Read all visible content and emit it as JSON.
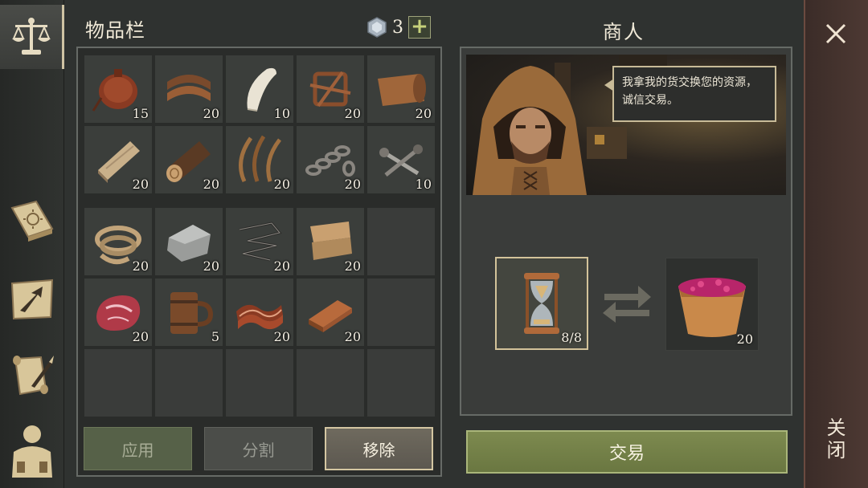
{
  "inventory": {
    "title": "物品栏",
    "gem_count": "3",
    "plus_label": "+",
    "grid_a": [
      {
        "icon": "leather-waterskin-icon",
        "qty": "15"
      },
      {
        "icon": "leather-strips-icon",
        "qty": "20"
      },
      {
        "icon": "fang-icon",
        "qty": "10"
      },
      {
        "icon": "leather-cord-icon",
        "qty": "20"
      },
      {
        "icon": "hide-scroll-icon",
        "qty": "20"
      },
      {
        "icon": "wooden-plank-icon",
        "qty": "20"
      },
      {
        "icon": "log-icon",
        "qty": "20"
      },
      {
        "icon": "fiber-icon",
        "qty": "20"
      },
      {
        "icon": "chain-icon",
        "qty": "20"
      },
      {
        "icon": "nails-icon",
        "qty": "10"
      }
    ],
    "grid_b": [
      {
        "icon": "rope-icon",
        "qty": "20"
      },
      {
        "icon": "stone-icon",
        "qty": "20"
      },
      {
        "icon": "wire-icon",
        "qty": "20"
      },
      {
        "icon": "cloth-icon",
        "qty": "20"
      },
      {
        "icon": "",
        "qty": ""
      },
      {
        "icon": "raw-meat-icon",
        "qty": "20"
      },
      {
        "icon": "wooden-mug-icon",
        "qty": "5"
      },
      {
        "icon": "bacon-icon",
        "qty": "20"
      },
      {
        "icon": "copper-ingot-icon",
        "qty": "20"
      },
      {
        "icon": "",
        "qty": ""
      },
      {
        "icon": "",
        "qty": ""
      },
      {
        "icon": "",
        "qty": ""
      },
      {
        "icon": "",
        "qty": ""
      },
      {
        "icon": "",
        "qty": ""
      },
      {
        "icon": "",
        "qty": ""
      }
    ],
    "buttons": {
      "apply": "应用",
      "split": "分割",
      "remove": "移除"
    }
  },
  "merchant": {
    "title": "商人",
    "speech": "我拿我的货交换您的资源，诚信交易。",
    "cost": {
      "icon": "hourglass-icon",
      "qty": "8/8"
    },
    "reward": {
      "icon": "berry-bowl-icon",
      "qty": "20"
    },
    "trade_label": "交易"
  },
  "close": {
    "label": "关闭"
  },
  "tabs": [
    "scales-icon",
    "recipe-book-icon",
    "map-arrow-icon",
    "quest-scroll-icon",
    "character-icon"
  ]
}
